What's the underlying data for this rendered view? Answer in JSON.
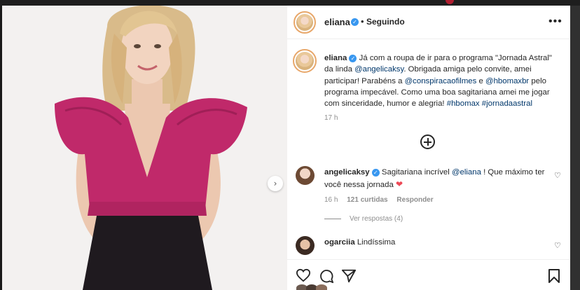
{
  "post": {
    "author": "eliana",
    "verified_symbol": "✓",
    "separator": "•",
    "follow_status": "Seguindo",
    "more_symbol": "•••",
    "caption": {
      "username": "eliana",
      "text_1": " Já com a roupa de ir para o programa \"Jornada Astral\" da linda ",
      "mention_1": "@angelicaksy",
      "text_2": ". Obrigada amiga pelo convite, amei participar! Parabéns a ",
      "mention_2": "@conspiracaofilmes",
      "text_3": " e ",
      "mention_3": "@hbomaxbr",
      "text_4": " pelo programa impecável. Como uma boa sagitariana amei me jogar com sinceridade, humor e alegria! ",
      "hashtag_1": "#hbomax",
      "hashtag_2": "#jornadaastral"
    },
    "time_ago": "17 h",
    "next_symbol": "›"
  },
  "comments": [
    {
      "username": "angelicaksy",
      "text_1": " Sagitariana incrível ",
      "mention": "@eliana",
      "text_2": " ! Que máximo ter você nessa jornada ",
      "emoji": "❤",
      "time": "16 h",
      "likes": "121 curtidas",
      "reply_label": "Responder",
      "view_replies": "Ver respostas (4)"
    },
    {
      "username": "ogarciia",
      "text": " Lindíssima"
    }
  ],
  "heart_symbol": "♡",
  "colors": {
    "accent_blue": "#3897f0",
    "link": "#00376b",
    "heart_red": "#ed4956",
    "dress_pink": "#c0296a"
  }
}
